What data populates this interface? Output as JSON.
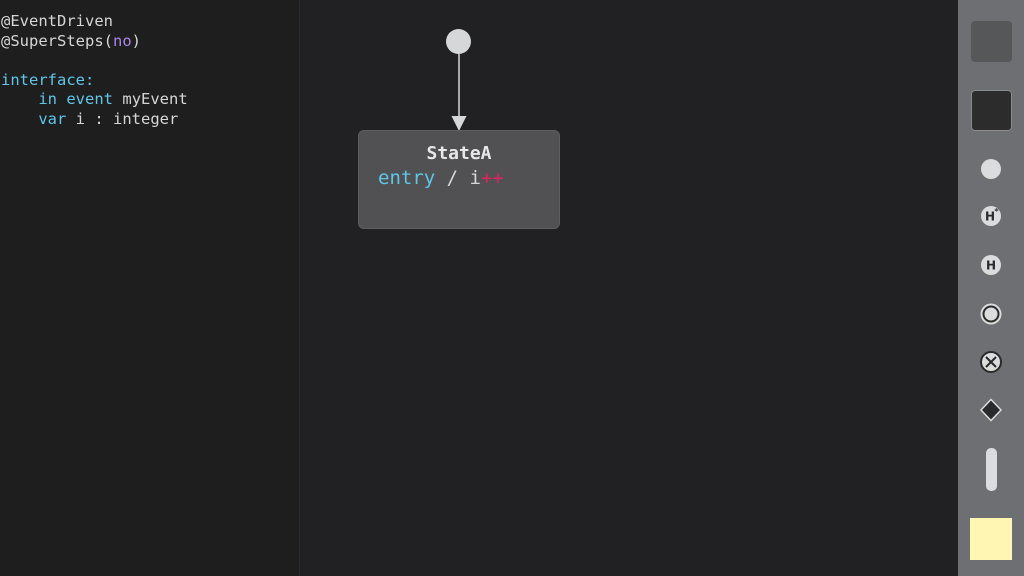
{
  "code": {
    "line1": "@EventDriven",
    "line2_prefix": "@SuperSteps(",
    "line2_value": "no",
    "line2_suffix": ")",
    "line3_keyword": "interface",
    "line3_colon": ":",
    "line4_kw1": "in",
    "line4_kw2": "event",
    "line4_name": "myEvent",
    "line5_kw": "var",
    "line5_rest": "i : integer"
  },
  "diagram": {
    "state_name": "StateA",
    "action_keyword": "entry",
    "action_sep": " / i",
    "action_op": "++"
  },
  "palette": {
    "tools": [
      "region-tool",
      "composite-state-tool",
      "initial-entry-tool",
      "deep-history-tool",
      "shallow-history-tool",
      "final-state-tool",
      "exit-tool",
      "choice-tool",
      "synchronization-tool",
      "note-tool"
    ]
  },
  "colors": {
    "keyword": "#5fc6e8",
    "value": "#a986e8",
    "operator": "#e0245e",
    "note": "#fff6b3"
  }
}
